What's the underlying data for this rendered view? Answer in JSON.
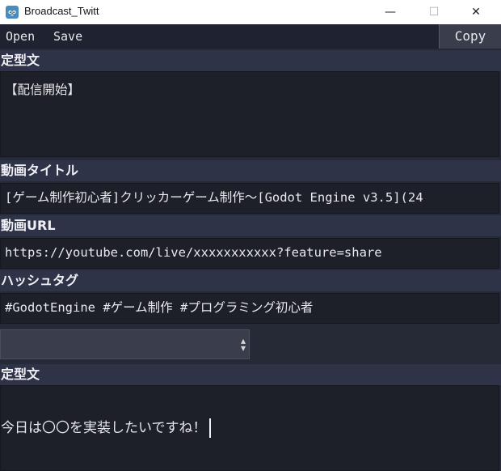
{
  "window": {
    "title": "Broadcast_Twitt",
    "minimize": "—",
    "maximize": "☐",
    "close": "✕"
  },
  "menu": {
    "open": "Open",
    "save": "Save",
    "copy": "Copy"
  },
  "sections": {
    "template1_label": "定型文",
    "template1_value": "【配信開始】",
    "video_title_label": "動画タイトル",
    "video_title_value": "[ゲーム制作初心者]クリッカーゲーム制作～[Godot Engine v3.5](24",
    "video_url_label": "動画URL",
    "video_url_value": "https://youtube.com/live/xxxxxxxxxxx?feature=share",
    "hashtag_label": "ハッシュタグ",
    "hashtag_value": "#GodotEngine #ゲーム制作 #プログラミング初心者",
    "select_value": "",
    "template2_label": "定型文",
    "template2_value": "今日は〇〇を実装したいですね！"
  },
  "icons": {
    "app": "godot-icon",
    "select_arrow": "updown-arrow-icon"
  },
  "colors": {
    "background": "#262a36",
    "label_bg": "#2e3347",
    "field_bg": "#1d1f29",
    "accent": "#478cbf"
  }
}
